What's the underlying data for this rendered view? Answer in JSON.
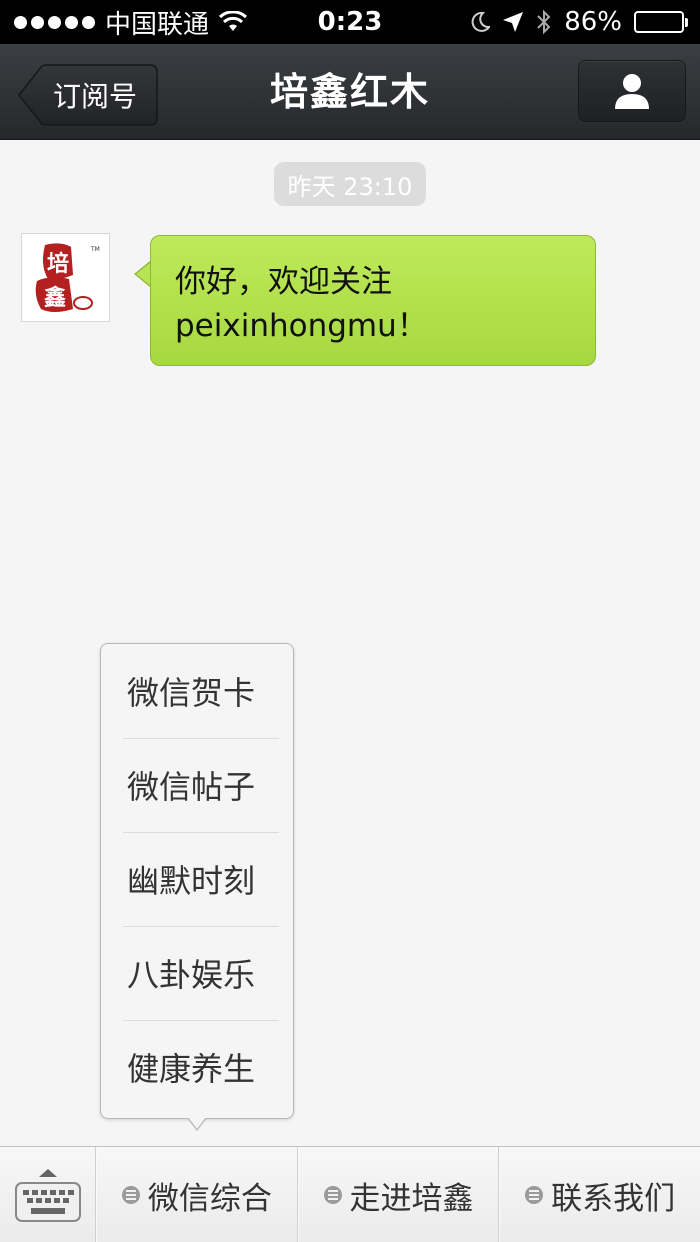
{
  "status_bar": {
    "carrier": "中国联通",
    "time": "0:23",
    "battery": "86%",
    "battery_level": 0.86
  },
  "nav": {
    "back_label": "订阅号",
    "title": "培鑫红木"
  },
  "chat": {
    "timestamp": "昨天 23:10",
    "avatar_text_top": "培",
    "avatar_text_bottom": "鑫",
    "message_line1": "你好，欢迎关注",
    "message_line2": "peixinhongmu！"
  },
  "popup_menu": {
    "items": [
      "微信贺卡",
      "微信帖子",
      "幽默时刻",
      "八卦娱乐",
      "健康养生"
    ]
  },
  "bottom_menu": {
    "tabs": [
      "微信综合",
      "走进培鑫",
      "联系我们"
    ]
  },
  "colors": {
    "bubble_green": "#b7e453",
    "nav_dark": "#2e3034",
    "brand_red": "#b3201f"
  },
  "icons": [
    "wifi-icon",
    "moon-icon",
    "location-arrow-icon",
    "bluetooth-icon",
    "battery-icon",
    "person-icon",
    "keyboard-icon",
    "menu-list-icon"
  ]
}
